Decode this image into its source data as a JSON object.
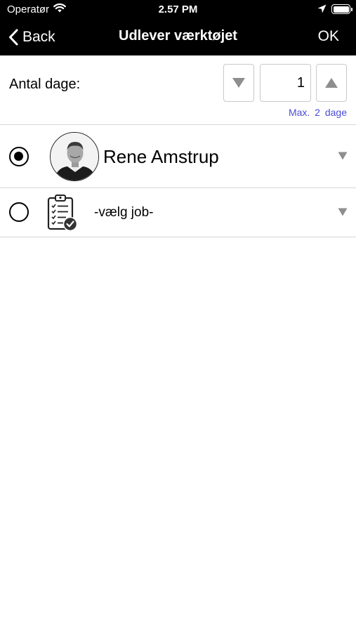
{
  "status_bar": {
    "carrier": "Operatør",
    "time": "2.57 PM",
    "wifi_icon": "wifi-icon",
    "location_icon": "location-arrow-icon",
    "battery_level": 1.0
  },
  "nav": {
    "back_label": "Back",
    "title": "Udlever værktøjet",
    "ok_label": "OK"
  },
  "days": {
    "label": "Antal dage:",
    "value": "1",
    "max_note": "Max. 2 dage"
  },
  "options": {
    "person": {
      "name": "Rene Amstrup",
      "selected": true
    },
    "job": {
      "placeholder": "-vælg job-",
      "selected": false
    }
  },
  "colors": {
    "nav_background": "#000000",
    "accent_link": "#4b4bd6",
    "caret_gray": "#8e8e8e"
  }
}
